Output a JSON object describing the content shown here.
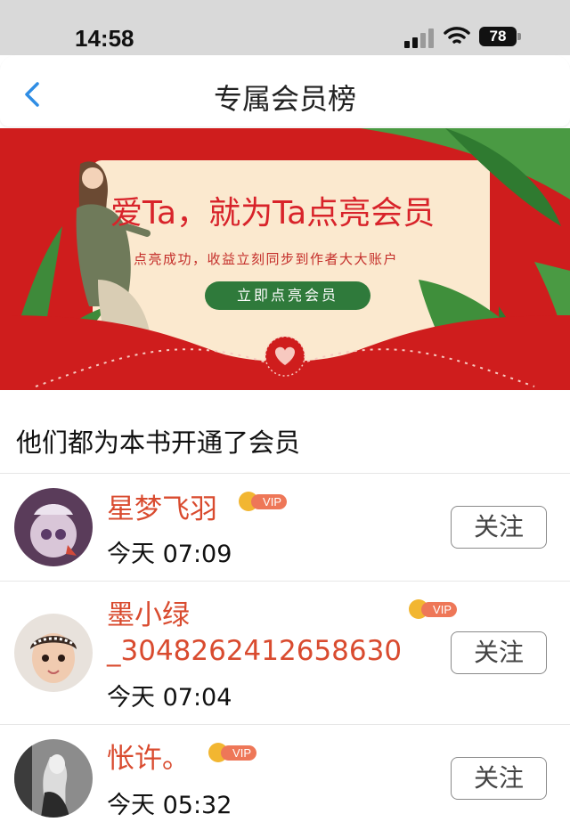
{
  "status_bar": {
    "time": "14:58",
    "battery": "78"
  },
  "nav": {
    "title": "专属会员榜"
  },
  "banner": {
    "headline": "爱Ta，就为Ta点亮会员",
    "subtext": "点亮成功，收益立刻同步到作者大大账户",
    "cta": "立即点亮会员"
  },
  "section": {
    "title": "他们都为本书开通了会员"
  },
  "members": [
    {
      "name": "星梦飞羽",
      "badge": "VIP",
      "time": "今天 07:09",
      "follow_label": "关注"
    },
    {
      "name_line1": "墨小绿",
      "name_line2": "_3048262412658630",
      "badge": "VIP",
      "time": "今天 07:04",
      "follow_label": "关注"
    },
    {
      "name": "怅许。",
      "badge": "VIP",
      "time": "今天 05:32",
      "follow_label": "关注"
    }
  ],
  "colors": {
    "accent_red": "#d94b2f",
    "banner_red": "#cf1d1d",
    "vip_orange": "#ee7758",
    "crown_gold": "#f2b631",
    "ios_blue": "#2f8de4"
  }
}
